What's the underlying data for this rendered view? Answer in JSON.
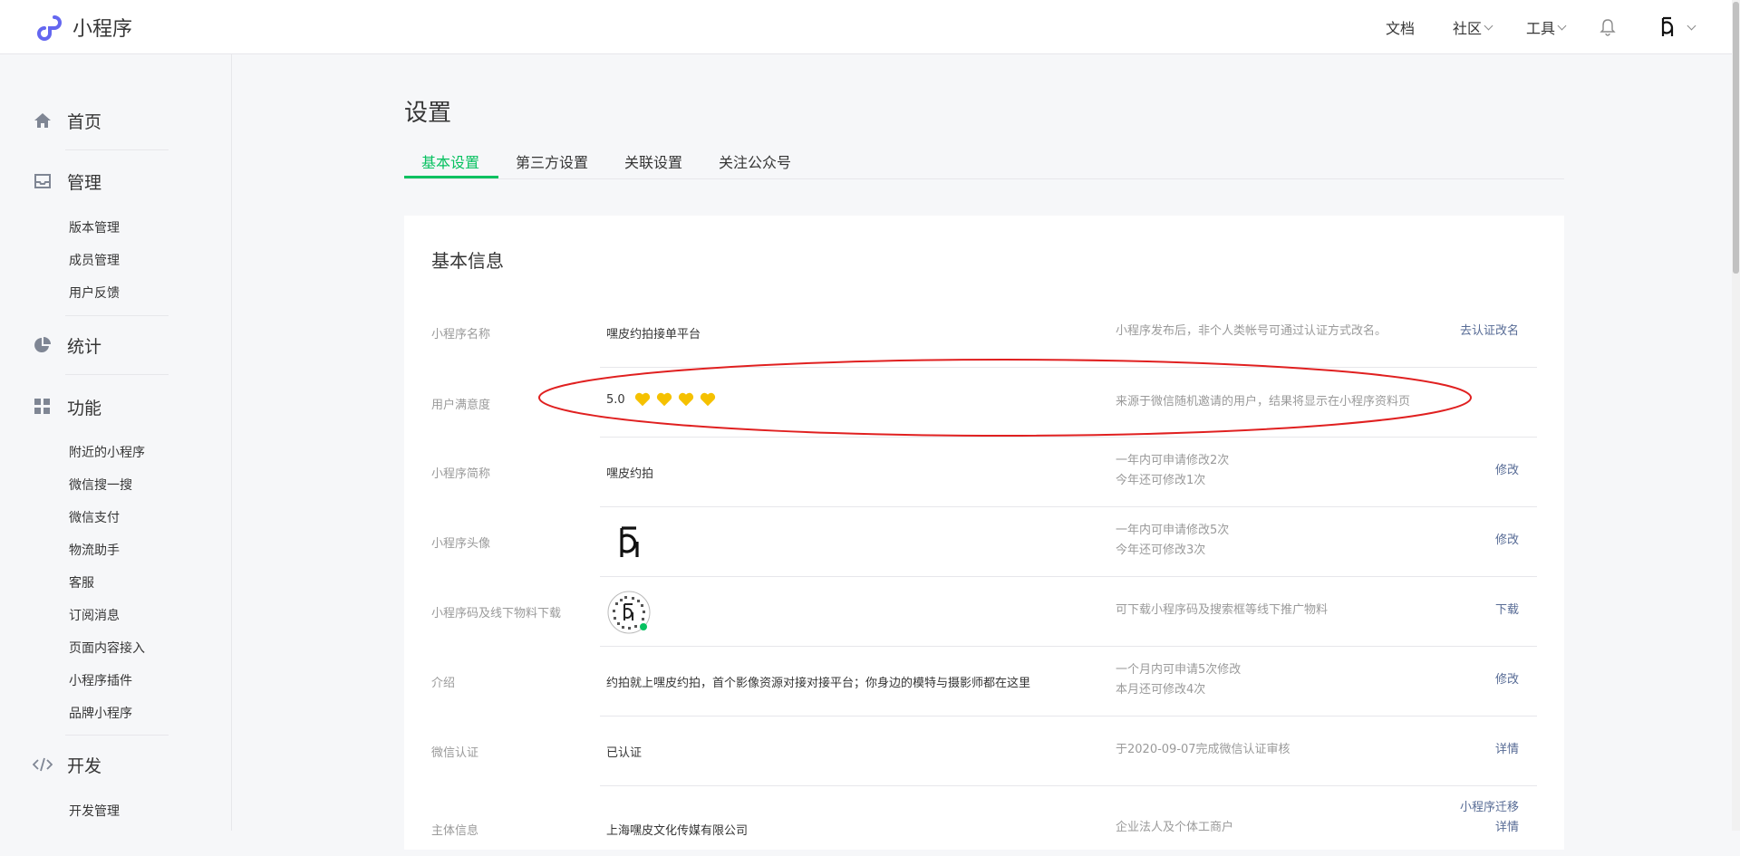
{
  "app": {
    "title": "小程序"
  },
  "topnav": {
    "docs": "文档",
    "community": "社区",
    "tools": "工具"
  },
  "sidebar": {
    "home": "首页",
    "manage": {
      "label": "管理",
      "items": [
        "版本管理",
        "成员管理",
        "用户反馈"
      ]
    },
    "stats": "统计",
    "features": {
      "label": "功能",
      "items": [
        "附近的小程序",
        "微信搜一搜",
        "微信支付",
        "物流助手",
        "客服",
        "订阅消息",
        "页面内容接入",
        "小程序插件",
        "品牌小程序"
      ]
    },
    "dev": {
      "label": "开发",
      "items": [
        "开发管理"
      ]
    }
  },
  "page": {
    "title": "设置"
  },
  "tabs": [
    "基本设置",
    "第三方设置",
    "关联设置",
    "关注公众号"
  ],
  "card": {
    "title": "基本信息",
    "rows": [
      {
        "label": "小程序名称",
        "value": "嘿皮约拍接单平台",
        "tip1": "小程序发布后，非个人类帐号可通过认证方式改名。",
        "tip2": "",
        "action1": "去认证改名",
        "action2": ""
      },
      {
        "label": "用户满意度",
        "value": "5.0",
        "tip1": "来源于微信随机邀请的用户，结果将显示在小程序资料页",
        "tip2": "",
        "action1": "",
        "action2": ""
      },
      {
        "label": "小程序简称",
        "value": "嘿皮约拍",
        "tip1": "一年内可申请修改2次",
        "tip2": "今年还可修改1次",
        "action1": "修改",
        "action2": ""
      },
      {
        "label": "小程序头像",
        "value": "",
        "tip1": "一年内可申请修改5次",
        "tip2": "今年还可修改3次",
        "action1": "修改",
        "action2": ""
      },
      {
        "label": "小程序码及线下物料下载",
        "value": "",
        "tip1": "可下载小程序码及搜索框等线下推广物料",
        "tip2": "",
        "action1": "下载",
        "action2": ""
      },
      {
        "label": "介绍",
        "value": "约拍就上嘿皮约拍，首个影像资源对接对接平台；你身边的模特与摄影师都在这里",
        "tip1": "一个月内可申请5次修改",
        "tip2": "本月还可修改4次",
        "action1": "修改",
        "action2": ""
      },
      {
        "label": "微信认证",
        "value": "已认证",
        "tip1": "于2020-09-07完成微信认证审核",
        "tip2": "",
        "action1": "详情",
        "action2": ""
      },
      {
        "label": "主体信息",
        "value": "上海嘿皮文化传媒有限公司",
        "tip1": "企业法人及个体工商户",
        "tip2": "",
        "action1": "小程序迁移",
        "action2": "详情"
      }
    ]
  },
  "satisfaction": {
    "stars": 4
  },
  "colors": {
    "accent": "#07c160",
    "link": "#576b95",
    "heart": "#f5c100",
    "annotation": "#e02020"
  },
  "icons": [
    "miniprogram-logo-icon",
    "bell-icon",
    "home-icon",
    "inbox-icon",
    "pie-chart-icon",
    "grid-icon",
    "code-icon",
    "heart-icon",
    "qr-code-icon"
  ]
}
